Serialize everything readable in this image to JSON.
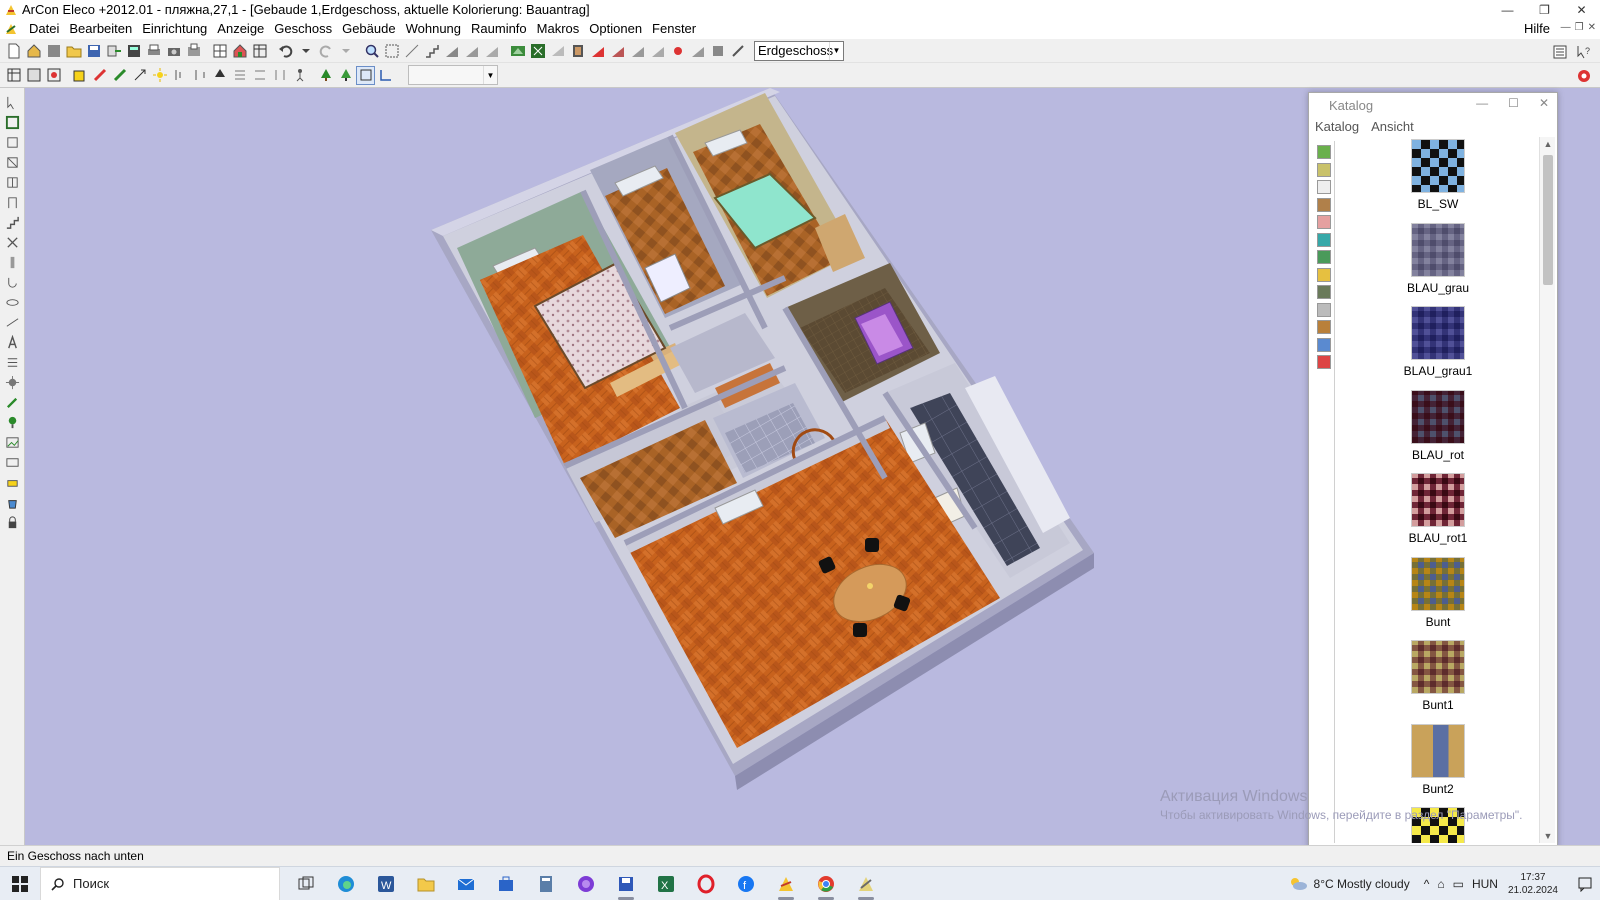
{
  "window": {
    "title": "ArCon Eleco  +2012.01  - пляжна,27,1 - [Gebaude 1,Erdgeschoss, aktuelle Kolorierung: Bauantrag]",
    "controls": [
      "—",
      "❐",
      "✕"
    ]
  },
  "menu": {
    "items": [
      "Datei",
      "Bearbeiten",
      "Einrichtung",
      "Anzeige",
      "Geschoss",
      "Gebäude",
      "Wohnung",
      "Rauminfo",
      "Makros",
      "Optionen",
      "Fenster"
    ],
    "help": "Hilfe"
  },
  "toolbar": {
    "floor_select": "Erdgeschoss",
    "empty_select": ""
  },
  "catalog": {
    "title": "Katalog",
    "menu": [
      "Katalog",
      "Ansicht"
    ],
    "items": [
      {
        "label": "BL_SW",
        "pattern": "checker",
        "colors": [
          "#111111",
          "#7fb2e0"
        ]
      },
      {
        "label": "BLAU_grau",
        "pattern": "plaid",
        "colors": [
          "#b7b6c9",
          "#8e8ca6"
        ]
      },
      {
        "label": "BLAU_grau1",
        "pattern": "plaid",
        "colors": [
          "#8f8fc4",
          "#5b5b9b"
        ]
      },
      {
        "label": "BLAU_rot",
        "pattern": "plaid",
        "colors": [
          "#7a3c52",
          "#8d90a6"
        ]
      },
      {
        "label": "BLAU_rot1",
        "pattern": "plaid",
        "colors": [
          "#e8c8c8",
          "#7a2f45"
        ]
      },
      {
        "label": "Bunt",
        "pattern": "plaid",
        "colors": [
          "#d8b84a",
          "#8c9bbf"
        ]
      },
      {
        "label": "Bunt1",
        "pattern": "plaid",
        "colors": [
          "#d9cf9f",
          "#9b6a6a"
        ]
      },
      {
        "label": "Bunt2",
        "pattern": "blocks",
        "colors": [
          "#c9a25a",
          "#5b6fa3"
        ]
      },
      {
        "label": "",
        "pattern": "checker",
        "colors": [
          "#111111",
          "#f5e94a"
        ]
      }
    ]
  },
  "status": {
    "text": "Ein Geschoss nach unten"
  },
  "watermark": {
    "title": "Активация Windows",
    "subtitle": "Чтобы активировать Windows, перейдите в раздел \"Параметры\"."
  },
  "taskbar": {
    "search_placeholder": "Поиск",
    "weather": "8°C  Mostly cloudy",
    "language": "HUN",
    "time": "17:37",
    "date": "21.02.2024"
  }
}
